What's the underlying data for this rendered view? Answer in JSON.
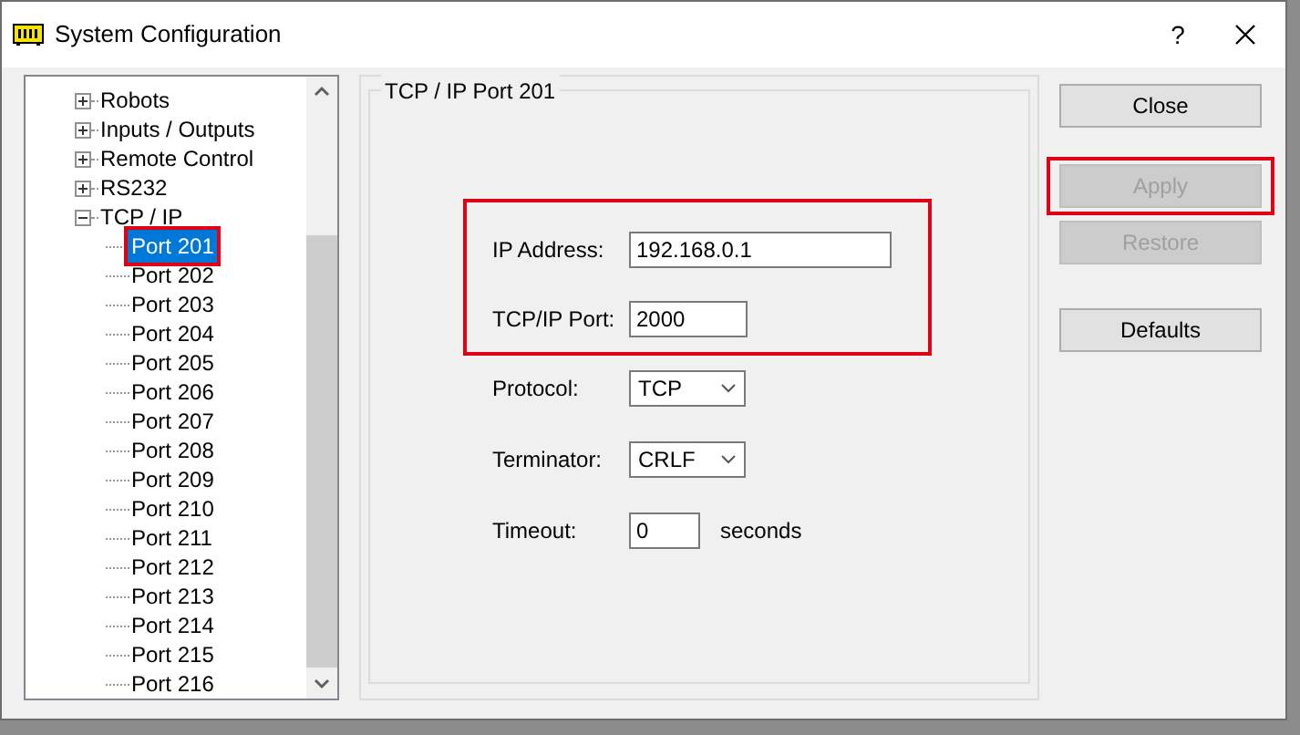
{
  "window": {
    "title": "System Configuration",
    "help": "?"
  },
  "tree": {
    "items": [
      {
        "label": "Robots",
        "expanded": false,
        "selected": false
      },
      {
        "label": "Inputs / Outputs",
        "expanded": false,
        "selected": false
      },
      {
        "label": "Remote Control",
        "expanded": false,
        "selected": false
      },
      {
        "label": "RS232",
        "expanded": false,
        "selected": false
      },
      {
        "label": "TCP / IP",
        "expanded": true,
        "selected": false,
        "children": [
          {
            "label": "Port 201",
            "selected": true,
            "highlighted": true
          },
          {
            "label": "Port 202",
            "selected": false
          },
          {
            "label": "Port 203",
            "selected": false
          },
          {
            "label": "Port 204",
            "selected": false
          },
          {
            "label": "Port 205",
            "selected": false
          },
          {
            "label": "Port 206",
            "selected": false
          },
          {
            "label": "Port 207",
            "selected": false
          },
          {
            "label": "Port 208",
            "selected": false
          },
          {
            "label": "Port 209",
            "selected": false
          },
          {
            "label": "Port 210",
            "selected": false
          },
          {
            "label": "Port 211",
            "selected": false
          },
          {
            "label": "Port 212",
            "selected": false
          },
          {
            "label": "Port 213",
            "selected": false
          },
          {
            "label": "Port 214",
            "selected": false
          },
          {
            "label": "Port 215",
            "selected": false
          },
          {
            "label": "Port 216",
            "selected": false
          }
        ]
      }
    ]
  },
  "group": {
    "title": "TCP / IP Port 201",
    "highlighted_fields": [
      {
        "label": "IP Address:",
        "value": "192.168.0.1",
        "kind": "wide"
      },
      {
        "label": "TCP/IP Port:",
        "value": "2000",
        "kind": "medium"
      }
    ],
    "fields": [
      {
        "label": "Protocol:",
        "value": "TCP",
        "kind": "select"
      },
      {
        "label": "Terminator:",
        "value": "CRLF",
        "kind": "select"
      },
      {
        "label": "Timeout:",
        "value": "0",
        "kind": "small",
        "unit": "seconds"
      }
    ]
  },
  "buttons": [
    {
      "label": "Close",
      "disabled": false,
      "highlighted": false
    },
    {
      "label": "Apply",
      "disabled": true,
      "highlighted": true
    },
    {
      "label": "Restore",
      "disabled": true,
      "highlighted": false
    },
    {
      "label": "Defaults",
      "disabled": false,
      "highlighted": false
    }
  ]
}
